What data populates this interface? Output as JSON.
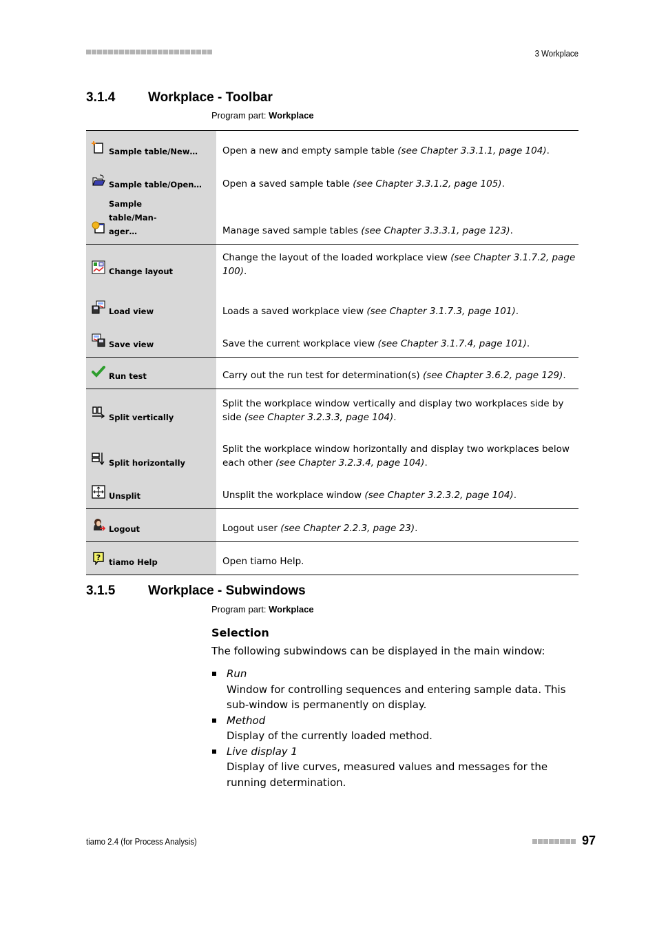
{
  "header": {
    "chapter": "3 Workplace"
  },
  "section_toolbar": {
    "number": "3.1.4",
    "title": "Workplace - Toolbar",
    "program_part_label": "Program part:",
    "program_part_value": "Workplace",
    "rows": [
      {
        "icon": "new-sample-table-icon",
        "label": "Sample table/New…",
        "text": "Open a new and empty sample table ",
        "ref": "(see Chapter 3.3.1.1, page 104)",
        "end": "."
      },
      {
        "icon": "open-folder-icon",
        "label": "Sample table/Open…",
        "text": "Open a saved sample table ",
        "ref": "(see Chapter 3.3.1.2, page 105)",
        "end": "."
      },
      {
        "icon": "manager-icon",
        "label": "Sample table/Man-ager…",
        "text": "Manage saved sample tables ",
        "ref": "(see Chapter 3.3.3.1, page 123)",
        "end": "."
      },
      {
        "icon": "change-layout-icon",
        "label": "Change layout",
        "text": "Change the layout of the loaded workplace view ",
        "ref": "(see Chapter 3.1.7.2, page 100)",
        "end": "."
      },
      {
        "icon": "load-view-icon",
        "label": "Load view",
        "text": "Loads a saved workplace view ",
        "ref": "(see Chapter 3.1.7.3, page 101)",
        "end": "."
      },
      {
        "icon": "save-view-icon",
        "label": "Save view",
        "text": "Save the current workplace view ",
        "ref": "(see Chapter 3.1.7.4, page 101)",
        "end": "."
      },
      {
        "icon": "checkmark-icon",
        "label": "Run test",
        "text": "Carry out the run test for determination(s) ",
        "ref": "(see Chapter 3.6.2, page 129)",
        "end": "."
      },
      {
        "icon": "split-vertical-icon",
        "label": "Split vertically",
        "text": "Split the workplace window vertically and display two workplaces side by side ",
        "ref": "(see Chapter 3.2.3.3, page 104)",
        "end": "."
      },
      {
        "icon": "split-horizontal-icon",
        "label": "Split horizontally",
        "text": "Split the workplace window horizontally and display two workplaces below each other ",
        "ref": "(see Chapter 3.2.3.4, page 104)",
        "end": "."
      },
      {
        "icon": "unsplit-icon",
        "label": "Unsplit",
        "text": "Unsplit the workplace window ",
        "ref": "(see Chapter 3.2.3.2, page 104)",
        "end": "."
      },
      {
        "icon": "logout-user-icon",
        "label": "Logout",
        "text": "Logout user ",
        "ref": "(see Chapter 2.2.3, page 23)",
        "end": "."
      },
      {
        "icon": "help-icon",
        "label": "tiamo Help",
        "text": "Open tiamo Help.",
        "ref": "",
        "end": ""
      }
    ]
  },
  "section_subwindows": {
    "number": "3.1.5",
    "title": "Workplace - Subwindows",
    "program_part_label": "Program part:",
    "program_part_value": "Workplace",
    "selection_heading": "Selection",
    "intro": "The following subwindows can be displayed in the main window:",
    "items": [
      {
        "term": "Run",
        "desc": "Window for controlling sequences and entering sample data. This sub-window is permanently on display."
      },
      {
        "term": "Method",
        "desc": "Display of the currently loaded method."
      },
      {
        "term": "Live display 1",
        "desc": "Display of live curves, measured values and messages for the running determination."
      }
    ]
  },
  "footer": {
    "product": "tiamo 2.4 (for Process Analysis)",
    "page_number": "97"
  }
}
